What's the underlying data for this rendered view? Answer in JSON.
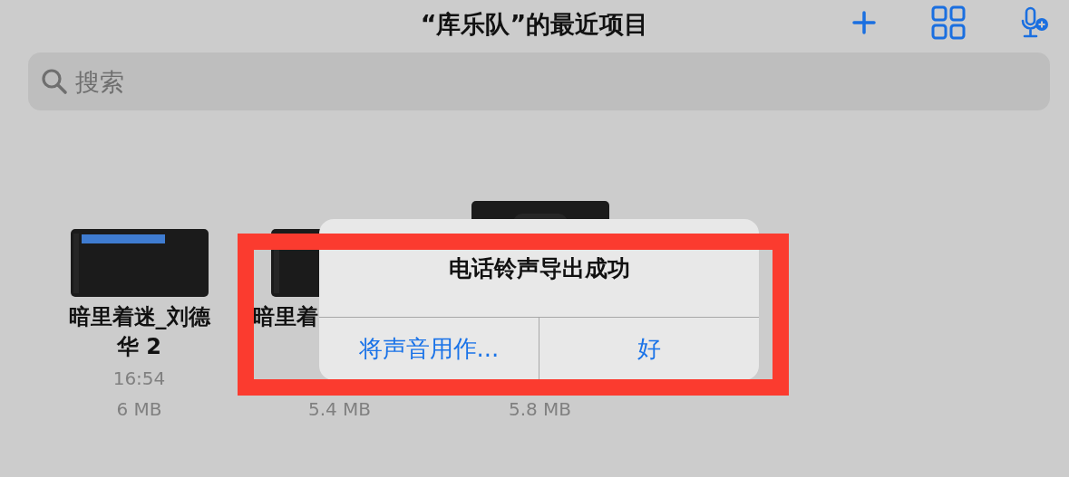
{
  "header": {
    "title": "“库乐队”的最近项目"
  },
  "search": {
    "placeholder": "搜索"
  },
  "files": [
    {
      "name": "暗里着迷_刘德华 2",
      "time": "16:54",
      "size": "6 MB",
      "partial": false,
      "kind": "wide"
    },
    {
      "name": "暗里着",
      "size": "5.4 MB",
      "partial": true,
      "kind": "wide"
    },
    {
      "size": "5.8 MB",
      "kind": "tall"
    }
  ],
  "alert": {
    "title": "电话铃声导出成功",
    "buttons": [
      {
        "label": "将声音用作..."
      },
      {
        "label": "好"
      }
    ]
  },
  "highlight": {
    "kind": "frame"
  }
}
